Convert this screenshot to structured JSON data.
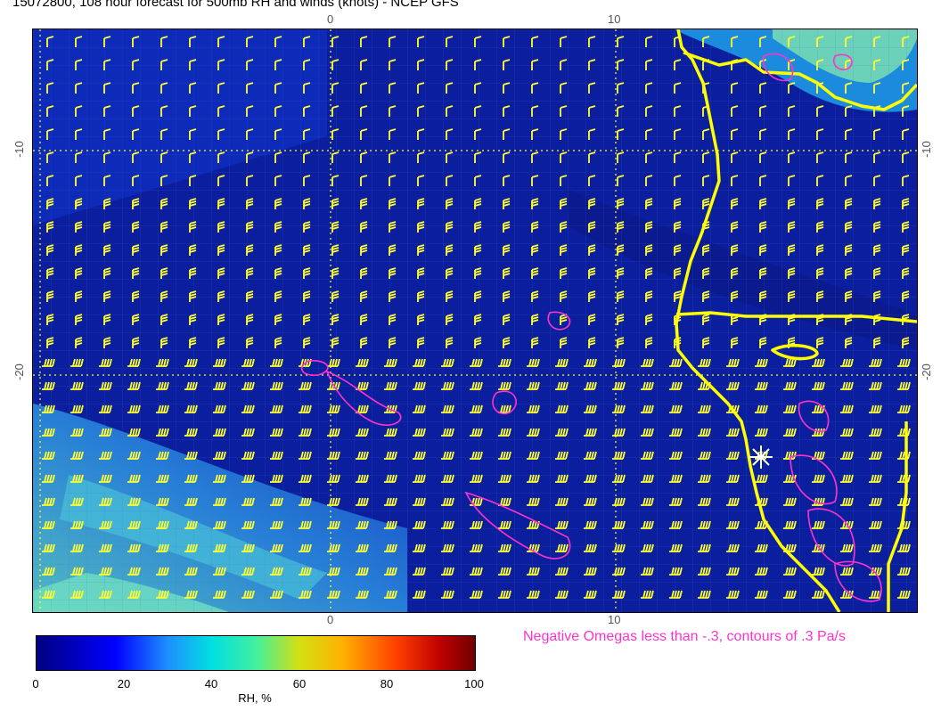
{
  "title": "15072800, 108 hour forecast for 500mb RH and winds (knots) - NCEP GFS",
  "map": {
    "x_ticks_top": [
      "0",
      "10"
    ],
    "x_ticks_bottom": [
      "0",
      "10"
    ],
    "y_ticks_left": [
      "-10",
      "-20"
    ],
    "y_ticks_right": [
      "-10",
      "-20"
    ],
    "background_color": "#0b1f9e",
    "barb_color": "#ffff33",
    "coast_color": "#ffff00",
    "omega_color": "#ff33cc",
    "marker": "star-marker"
  },
  "omega_note": "Negative Omegas less than -.3, contours of .3 Pa/s",
  "colorbar": {
    "labels": [
      "0",
      "20",
      "40",
      "60",
      "80",
      "100"
    ],
    "title": "RH, %"
  }
}
